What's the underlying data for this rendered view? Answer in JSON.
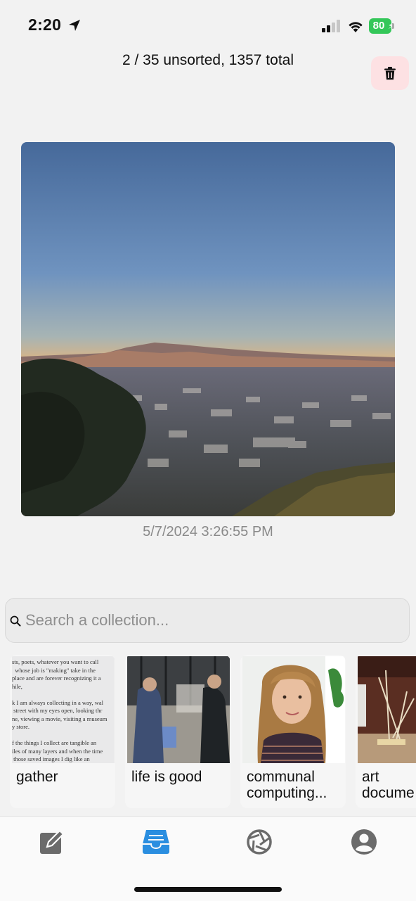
{
  "status_bar": {
    "time": "2:20",
    "battery": "80"
  },
  "header": {
    "count_text": "2 / 35 unsorted, 1357 total"
  },
  "photo": {
    "date": "5/7/2024 3:26:55 PM"
  },
  "search": {
    "placeholder": "Search a collection..."
  },
  "collections": [
    {
      "label": "gather",
      "thumb": "quote-text",
      "quote": "sts, poets, whatever you want to call\n  whose job is \"making\" take in the\nplace and are forever recognizing it a\nhile,\n\nk I am always collecting in a way, wal\n street with my eyes open, looking thr\nne, viewing a movie, visiting a museum\ny store.\n\nf the things I collect are tangible an\niles of many layers and when the time\n those saved images I dig like an\nologist and sometimes find what I want\nmes don't.\"\n\nter Corita Kent"
    },
    {
      "label": "life is good",
      "thumb": "balcony-photo"
    },
    {
      "label": "communal\ncomputing...",
      "thumb": "portrait-photo"
    },
    {
      "label": "art\ndocume",
      "thumb": "studio-photo"
    }
  ],
  "tabs": [
    {
      "name": "compose",
      "icon": "compose-icon",
      "active": false
    },
    {
      "name": "inbox",
      "icon": "inbox-tray-icon",
      "active": true
    },
    {
      "name": "explore",
      "icon": "aperture-icon",
      "active": false
    },
    {
      "name": "profile",
      "icon": "profile-icon",
      "active": false
    }
  ],
  "colors": {
    "accent": "#2a8ee0",
    "delete_bg": "#fde1e3",
    "battery": "#34c759",
    "icon_gray": "#6b6b6b"
  }
}
